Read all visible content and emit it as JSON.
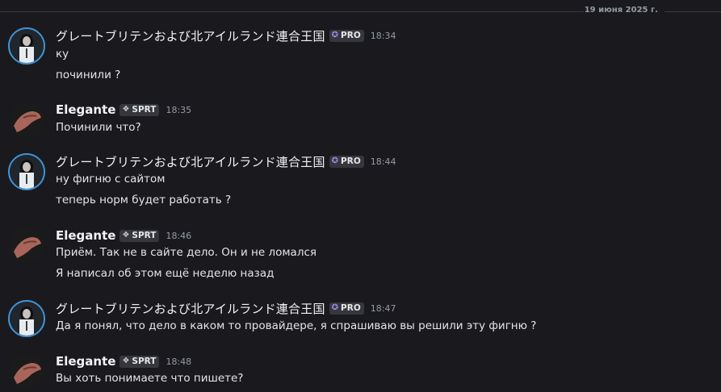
{
  "date_divider": "19 июня 2025 г.",
  "users": {
    "pro_user": {
      "name": "グレートブリテンおよび北アイルランド連合王国",
      "badge": "PRO",
      "badge_icon": "feather-icon",
      "avatar_ring_color": "#3f94d6"
    },
    "sprt_user": {
      "name": "Elegante",
      "badge": "SPRT",
      "badge_icon": "diamond-support-icon"
    }
  },
  "messages": [
    {
      "author": "pro_user",
      "time": "18:34",
      "lines": [
        "ку",
        "починили ?"
      ]
    },
    {
      "author": "sprt_user",
      "time": "18:35",
      "lines": [
        "Починили что?"
      ]
    },
    {
      "author": "pro_user",
      "time": "18:44",
      "lines": [
        "ну фигню с сайтом",
        "теперь норм будет работать ?"
      ]
    },
    {
      "author": "sprt_user",
      "time": "18:46",
      "lines": [
        "Приём. Так не в сайте дело. Он и не ломался",
        "Я написал об этом ещё неделю назад"
      ]
    },
    {
      "author": "pro_user",
      "time": "18:47",
      "lines": [
        "Да я понял, что дело в каком то провайдере, я спрашиваю вы решили эту фигню ?"
      ]
    },
    {
      "author": "sprt_user",
      "time": "18:48",
      "lines": [
        "Вы хоть понимаете что пишете?"
      ]
    }
  ]
}
